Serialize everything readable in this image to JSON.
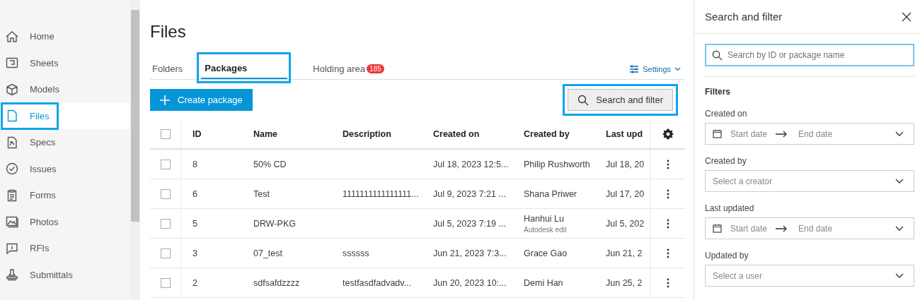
{
  "nav": [
    {
      "label": "Home",
      "selected": false,
      "highlighted": false
    },
    {
      "label": "Sheets",
      "selected": false,
      "highlighted": false
    },
    {
      "label": "Models",
      "selected": false,
      "highlighted": false
    },
    {
      "label": "Files",
      "selected": true,
      "highlighted": true
    },
    {
      "label": "Specs",
      "selected": false,
      "highlighted": false
    },
    {
      "label": "Issues",
      "selected": false,
      "highlighted": false
    },
    {
      "label": "Forms",
      "selected": false,
      "highlighted": false
    },
    {
      "label": "Photos",
      "selected": false,
      "highlighted": false
    },
    {
      "label": "RFIs",
      "selected": false,
      "highlighted": false
    },
    {
      "label": "Submittals",
      "selected": false,
      "highlighted": false
    }
  ],
  "page_title": "Files",
  "tabs": [
    {
      "label": "Folders",
      "selected": false,
      "highlighted": false
    },
    {
      "label": "Packages",
      "selected": true,
      "highlighted": true
    },
    {
      "label": "Holding area",
      "badge": "185",
      "selected": false,
      "highlighted": false
    }
  ],
  "settings_link": "Settings",
  "create_button": "Create package",
  "search_button": {
    "label": "Search and filter",
    "highlighted": true
  },
  "table": {
    "select_all_checked": false,
    "columns": [
      "ID",
      "Name",
      "Description",
      "Created on",
      "Created by",
      "Last upd"
    ],
    "rows": [
      {
        "checked": false,
        "cells": [
          "8",
          "50% CD",
          "",
          "Jul 18, 2023 12:5...",
          "Philip Rushworth",
          "Jul 18, 20"
        ]
      },
      {
        "checked": false,
        "cells": [
          "6",
          "Test",
          "1111111111111111...",
          "Jul 9, 2023 7:21 ...",
          "Shana Priwer",
          "Jul 17, 20"
        ]
      },
      {
        "checked": false,
        "cells": [
          "5",
          "DRW-PKG",
          "",
          "Jul 5, 2023 7:19 ...",
          "Hanhui Lu",
          "Jul 5, 202"
        ],
        "creator_note": "Autodesk edit"
      },
      {
        "checked": false,
        "cells": [
          "3",
          "07_test",
          "ssssss",
          "Jun 21, 2023 7:3...",
          "Grace Gao",
          "Jun 21, 2"
        ]
      },
      {
        "checked": false,
        "cells": [
          "2",
          "sdfsafdzzzz",
          "testfasdfadvadv...",
          "Jun 20, 2023 10:...",
          "Demi Han",
          "Jun 25, 2"
        ]
      }
    ]
  },
  "panel": {
    "title": "Search and filter",
    "search_placeholder": "Search by ID or package name",
    "filters_heading": "Filters",
    "filters": [
      {
        "kind": "daterange",
        "label": "Created on",
        "start": "Start date",
        "end": "End date"
      },
      {
        "kind": "select",
        "label": "Created by",
        "placeholder": "Select a creator"
      },
      {
        "kind": "daterange",
        "label": "Last updated",
        "start": "Start date",
        "end": "End date"
      },
      {
        "kind": "select",
        "label": "Updated by",
        "placeholder": "Select a user"
      }
    ]
  }
}
